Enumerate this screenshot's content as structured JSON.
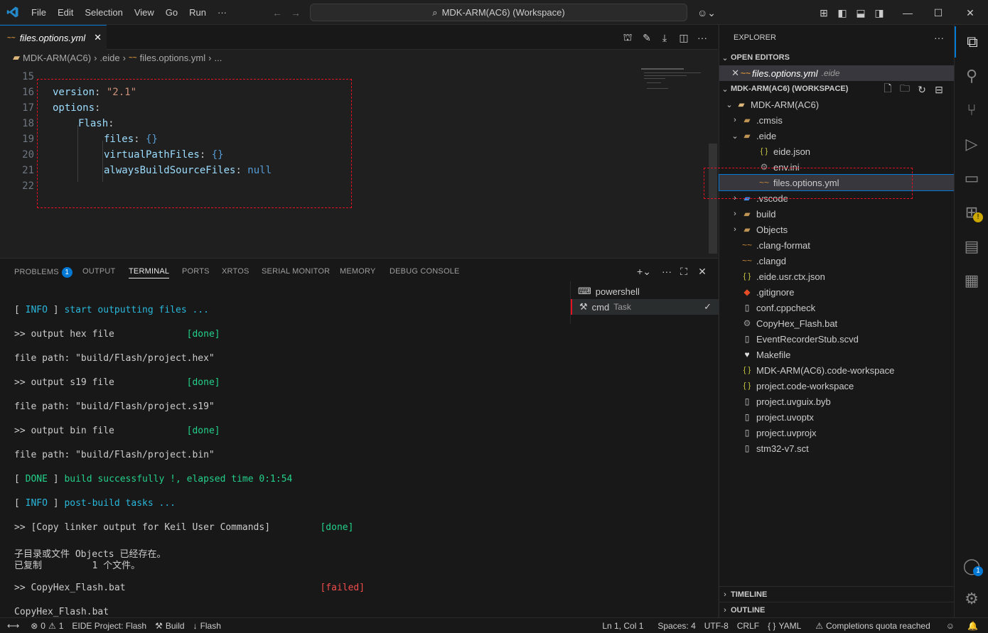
{
  "menu": [
    "File",
    "Edit",
    "Selection",
    "View",
    "Go",
    "Run",
    "···"
  ],
  "search": {
    "label": "MDK-ARM(AC6) (Workspace)"
  },
  "tab": {
    "title": "files.options.yml",
    "icon": "yml-icon"
  },
  "breadcrumb": [
    "MDK-ARM(AC6)",
    "›",
    ".eide",
    "›",
    "files.options.yml",
    "›",
    "..."
  ],
  "editor": {
    "lines": [
      {
        "n": "15"
      },
      {
        "n": "16",
        "key": "version",
        "sep": ": ",
        "val": "\"2.1\""
      },
      {
        "n": "17",
        "key": "options",
        "sep": ":"
      },
      {
        "n": "18",
        "key": "Flash",
        "sep": ":"
      },
      {
        "n": "19",
        "key": "files",
        "sep": ": ",
        "val": "{}"
      },
      {
        "n": "20",
        "key": "virtualPathFiles",
        "sep": ": ",
        "val": "{}"
      },
      {
        "n": "21",
        "key": "alwaysBuildSourceFiles",
        "sep": ": ",
        "val": "null"
      },
      {
        "n": "22"
      }
    ]
  },
  "panel": {
    "tabs": [
      "PROBLEMS",
      "OUTPUT",
      "TERMINAL",
      "PORTS",
      "XRTOS",
      "SERIAL MONITOR",
      "MEMORY",
      "DEBUG CONSOLE"
    ],
    "problems_count": "1",
    "terminals": [
      {
        "label": "powershell",
        "tag": ""
      },
      {
        "label": "cmd",
        "tag": "Task"
      }
    ]
  },
  "terminal": {
    "l1a": "[ ",
    "l1b": "INFO",
    "l1c": " ] ",
    "l1d": "start outputting files ...",
    "l2a": ">> output hex file             ",
    "l2b": "[done]",
    "l3": "file path: \"build/Flash/project.hex\"",
    "l4a": ">> output s19 file             ",
    "l4b": "[done]",
    "l5": "file path: \"build/Flash/project.s19\"",
    "l6a": ">> output bin file             ",
    "l6b": "[done]",
    "l7": "file path: \"build/Flash/project.bin\"",
    "l8a": "[ ",
    "l8b": "DONE",
    "l8c": " ] ",
    "l8d": "build successfully !, elapsed time 0:1:54",
    "l9a": "[ ",
    "l9b": "INFO",
    "l9c": " ] ",
    "l9d": "post-build tasks ...",
    "l10a": ">> [Copy linker output for Keil User Commands]         ",
    "l10b": "[done]",
    "l11": "子目录或文件 Objects 已经存在。",
    "l12": "已复制         1 个文件。",
    "l13a": ">> CopyHex_Flash.bat                                   ",
    "l13b": "[failed]",
    "l14": "CopyHex_Flash.bat"
  },
  "explorer": {
    "title": "EXPLORER",
    "open_editors": "OPEN EDITORS",
    "open_file": "files.options.yml",
    "open_file_dir": ".eide",
    "workspace": "MDK-ARM(AC6) (WORKSPACE)",
    "tree": [
      {
        "label": "MDK-ARM(AC6)",
        "depth": 1,
        "chev": "⌄",
        "icon": "root-folder-icon"
      },
      {
        "label": ".cmsis",
        "depth": 2,
        "chev": "›",
        "icon": "folder-icon"
      },
      {
        "label": ".eide",
        "depth": 2,
        "chev": "⌄",
        "icon": "folder-icon"
      },
      {
        "label": "eide.json",
        "depth": 3,
        "chev": "",
        "icon": "json-icon"
      },
      {
        "label": "env.ini",
        "depth": 3,
        "chev": "",
        "icon": "gear-icon"
      },
      {
        "label": "files.options.yml",
        "depth": 3,
        "chev": "",
        "icon": "yml-icon"
      },
      {
        "label": ".vscode",
        "depth": 2,
        "chev": "›",
        "icon": "vscode-folder-icon"
      },
      {
        "label": "build",
        "depth": 2,
        "chev": "›",
        "icon": "folder-icon"
      },
      {
        "label": "Objects",
        "depth": 2,
        "chev": "›",
        "icon": "folder-icon"
      },
      {
        "label": ".clang-format",
        "depth": 2,
        "chev": "",
        "icon": "config-icon"
      },
      {
        "label": ".clangd",
        "depth": 2,
        "chev": "",
        "icon": "config-icon"
      },
      {
        "label": ".eide.usr.ctx.json",
        "depth": 2,
        "chev": "",
        "icon": "json-icon"
      },
      {
        "label": ".gitignore",
        "depth": 2,
        "chev": "",
        "icon": "git-icon"
      },
      {
        "label": "conf.cppcheck",
        "depth": 2,
        "chev": "",
        "icon": "file-icon"
      },
      {
        "label": "CopyHex_Flash.bat",
        "depth": 2,
        "chev": "",
        "icon": "gear-icon"
      },
      {
        "label": "EventRecorderStub.scvd",
        "depth": 2,
        "chev": "",
        "icon": "file-icon"
      },
      {
        "label": "Makefile",
        "depth": 2,
        "chev": "",
        "icon": "makefile-icon"
      },
      {
        "label": "MDK-ARM(AC6).code-workspace",
        "depth": 2,
        "chev": "",
        "icon": "json-icon"
      },
      {
        "label": "project.code-workspace",
        "depth": 2,
        "chev": "",
        "icon": "json-icon"
      },
      {
        "label": "project.uvguix.byb",
        "depth": 2,
        "chev": "",
        "icon": "file-icon"
      },
      {
        "label": "project.uvoptx",
        "depth": 2,
        "chev": "",
        "icon": "file-icon"
      },
      {
        "label": "project.uvprojx",
        "depth": 2,
        "chev": "",
        "icon": "file-icon"
      },
      {
        "label": "stm32-v7.sct",
        "depth": 2,
        "chev": "",
        "icon": "file-icon"
      }
    ],
    "timeline": "TIMELINE",
    "outline": "OUTLINE"
  },
  "account_badge": "1",
  "status": {
    "errors": "0",
    "warnings": "1",
    "project": "EIDE Project: Flash",
    "build": "Build",
    "flash": "Flash",
    "position": "Ln 1, Col 1",
    "spaces": "Spaces: 4",
    "encoding": "UTF-8",
    "eol": "CRLF",
    "lang_icon": "{ }",
    "language": "YAML",
    "copilot": "Completions quota reached"
  }
}
